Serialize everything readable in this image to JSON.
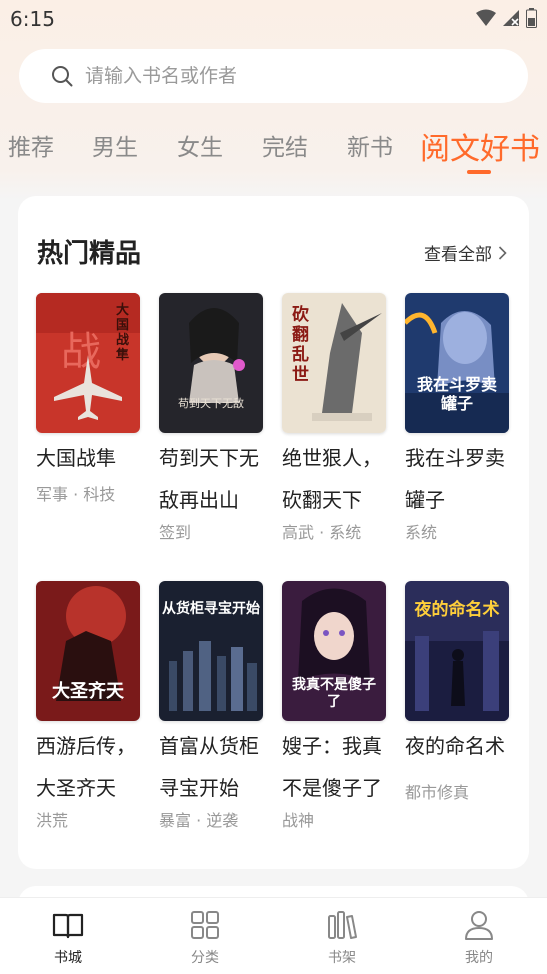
{
  "status": {
    "time": "6:15"
  },
  "search": {
    "placeholder": "请输入书名或作者"
  },
  "tabs": [
    {
      "label": "推荐"
    },
    {
      "label": "男生"
    },
    {
      "label": "女生"
    },
    {
      "label": "完结"
    },
    {
      "label": "新书"
    },
    {
      "label": "阅文好书",
      "active": true
    }
  ],
  "section": {
    "title": "热门精品",
    "view_all": "查看全部"
  },
  "books": [
    {
      "title": "大国战隼",
      "tags": "军事 · 科技",
      "cover_text": "大国战隼",
      "cover_bg": "#c8352a"
    },
    {
      "title": "苟到天下无敌再出山",
      "tags": "签到",
      "cover_text": "苟到天下无敌",
      "cover_bg": "#2a2a2e"
    },
    {
      "title": "绝世狠人，砍翻天下",
      "tags": "高武 · 系统",
      "cover_text": "砍翻乱世",
      "cover_bg": "#e9dfcd"
    },
    {
      "title": "我在斗罗卖罐子",
      "tags": "系统",
      "cover_text": "我在斗罗卖罐子",
      "cover_bg": "#1f3a6e"
    },
    {
      "title": "西游后传，大圣齐天",
      "tags": "洪荒",
      "cover_text": "大圣齐天",
      "cover_bg": "#8a1f1f"
    },
    {
      "title": "首富从货柜寻宝开始",
      "tags": "暴富 · 逆袭",
      "cover_text": "从货柜寻宝开始",
      "cover_bg": "#1d2433"
    },
    {
      "title": "嫂子：我真不是傻子了",
      "tags": "战神",
      "cover_text": "我真不是傻子了",
      "cover_bg": "#3a1c3e"
    },
    {
      "title": "夜的命名术",
      "tags": "都市修真",
      "cover_text": "夜的命名术",
      "cover_bg": "#2b2d5a"
    }
  ],
  "nav": [
    {
      "label": "书城",
      "icon": "book-open-icon",
      "active": true
    },
    {
      "label": "分类",
      "icon": "grid-icon"
    },
    {
      "label": "书架",
      "icon": "bookshelf-icon"
    },
    {
      "label": "我的",
      "icon": "user-icon"
    }
  ],
  "colors": {
    "accent": "#ff6a2b",
    "text": "#222222",
    "muted": "#999999"
  }
}
